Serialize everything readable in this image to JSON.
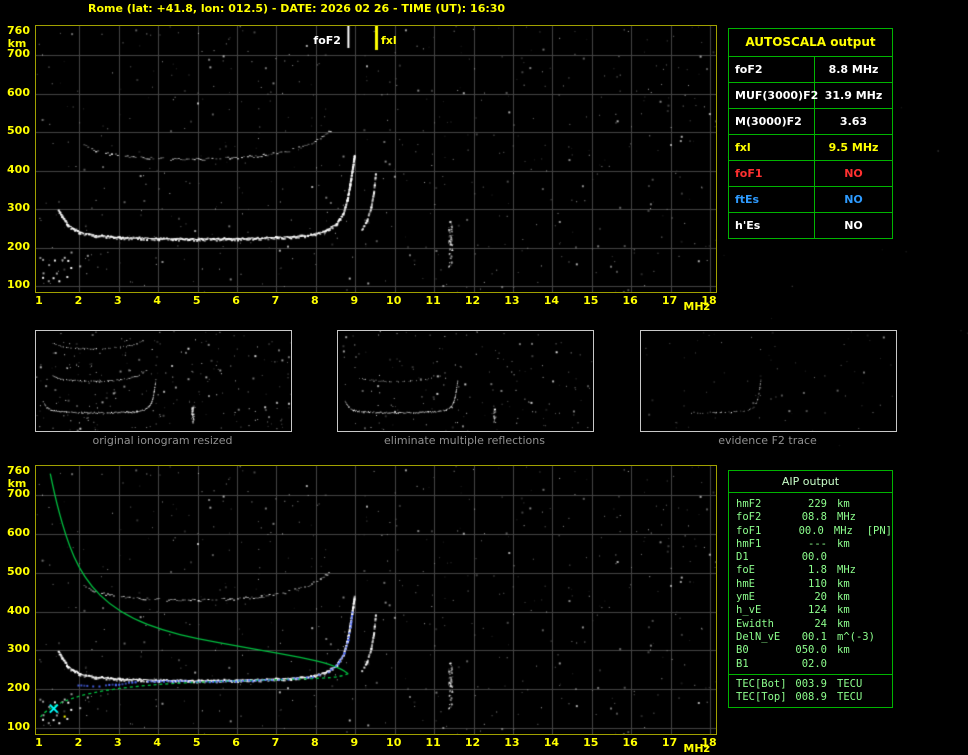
{
  "header": {
    "title": "Rome (lat: +41.8, lon: 012.5) - DATE: 2026 02 26 - TIME (UT): 16:30"
  },
  "colors": {
    "accent_yellow": "#ffff00",
    "grid": "#454545",
    "panel_border": "#a0a000",
    "table_border": "#00b400",
    "aip_text": "#8dff8d",
    "caption_gray": "#909090",
    "trace_blue": "#4d6bff",
    "profile_green": "#00c040",
    "value_red": "#ff3030",
    "value_blue": "#2e9bff",
    "value_white": "#ffffff"
  },
  "axes": {
    "y_ticks": [
      760,
      700,
      600,
      500,
      400,
      300,
      200,
      100
    ],
    "y_unit": "km",
    "x_ticks": [
      1,
      2,
      3,
      4,
      5,
      6,
      7,
      8,
      9,
      10,
      11,
      12,
      13,
      14,
      15,
      16,
      17,
      18
    ],
    "x_unit": "MHz",
    "x_range": [
      1,
      18
    ],
    "y_range": [
      100,
      760
    ]
  },
  "top_panel": {
    "fof2_label": "foF2",
    "fxl_label": "fxl"
  },
  "autoscala": {
    "title": "AUTOSCALA output",
    "rows": [
      {
        "label": "foF2",
        "value": "8.8 MHz",
        "color": "#ffffff"
      },
      {
        "label": "MUF(3000)F2",
        "value": "31.9 MHz",
        "color": "#ffffff"
      },
      {
        "label": "M(3000)F2",
        "value": "3.63",
        "color": "#ffffff"
      },
      {
        "label": "fxl",
        "value": "9.5 MHz",
        "color": "#ffff00"
      },
      {
        "label": "foF1",
        "value": "NO",
        "color": "#ff3030"
      },
      {
        "label": "ftEs",
        "value": "NO",
        "color": "#2e9bff"
      },
      {
        "label": "h'Es",
        "value": "NO",
        "color": "#ffffff"
      }
    ]
  },
  "thumbnails": [
    {
      "caption": "original ionogram resized"
    },
    {
      "caption": "eliminate multiple reflections"
    },
    {
      "caption": "evidence F2 trace"
    }
  ],
  "aip": {
    "title": "AIP output",
    "rows": [
      [
        "hmF2",
        "229",
        "km",
        ""
      ],
      [
        "foF2",
        "08.8",
        "MHz",
        ""
      ],
      [
        "foF1",
        "00.0",
        "MHz",
        "[PN]"
      ],
      [
        "hmF1",
        "---",
        "km",
        ""
      ],
      [
        "D1",
        "00.0",
        "",
        ""
      ],
      [
        "foE",
        "1.8",
        "MHz",
        ""
      ],
      [
        "hmE",
        "110",
        "km",
        ""
      ],
      [
        "ymE",
        "20",
        "km",
        ""
      ],
      [
        "h_vE",
        "124",
        "km",
        ""
      ],
      [
        "Ewidth",
        "24",
        "km",
        ""
      ],
      [
        "DelN_vE",
        "00.1",
        "m^(-3)",
        ""
      ],
      [
        "B0",
        "050.0",
        "km",
        ""
      ],
      [
        "B1",
        "02.0",
        "",
        ""
      ]
    ],
    "tec_rows": [
      [
        "TEC[Bot]",
        "003.9",
        "TECU"
      ],
      [
        "TEC[Top]",
        "008.9",
        "TECU"
      ]
    ]
  },
  "chart_data": {
    "type": "scatter",
    "title": "Ionogram - virtual height (km) vs sounding frequency (MHz)",
    "xlabel": "MHz",
    "ylabel": "km",
    "xlim": [
      1,
      18
    ],
    "ylim": [
      100,
      760
    ],
    "grid": true,
    "markers": {
      "foF2_mhz": 8.8,
      "fxl_mhz": 9.5
    },
    "traces": {
      "f2_main": [
        [
          1.45,
          298
        ],
        [
          1.7,
          258
        ],
        [
          2.0,
          240
        ],
        [
          2.4,
          232
        ],
        [
          3.0,
          227
        ],
        [
          4.0,
          224
        ],
        [
          5.0,
          223
        ],
        [
          6.0,
          224
        ],
        [
          7.0,
          227
        ],
        [
          7.7,
          231
        ],
        [
          8.2,
          243
        ],
        [
          8.5,
          262
        ],
        [
          8.68,
          290
        ],
        [
          8.78,
          325
        ],
        [
          8.85,
          365
        ],
        [
          8.92,
          410
        ],
        [
          8.96,
          440
        ]
      ],
      "second_hop": [
        [
          2.1,
          466
        ],
        [
          2.4,
          452
        ],
        [
          2.8,
          443
        ],
        [
          3.4,
          436
        ],
        [
          4.2,
          431
        ],
        [
          5.0,
          430
        ],
        [
          5.8,
          433
        ],
        [
          6.6,
          440
        ],
        [
          7.2,
          450
        ],
        [
          7.7,
          464
        ],
        [
          8.1,
          484
        ],
        [
          8.35,
          505
        ]
      ],
      "x_mode_rise": [
        [
          9.15,
          248
        ],
        [
          9.28,
          272
        ],
        [
          9.38,
          305
        ],
        [
          9.45,
          345
        ],
        [
          9.5,
          395
        ]
      ],
      "blue_trace": [
        [
          1.95,
          213
        ],
        [
          2.4,
          210
        ],
        [
          2.9,
          214
        ],
        [
          3.4,
          221
        ],
        [
          4.2,
          223
        ],
        [
          5.2,
          222
        ],
        [
          6.2,
          224
        ],
        [
          7.2,
          227
        ],
        [
          7.9,
          233
        ],
        [
          8.3,
          247
        ],
        [
          8.55,
          268
        ],
        [
          8.7,
          295
        ],
        [
          8.8,
          330
        ],
        [
          8.87,
          370
        ],
        [
          8.9,
          400
        ]
      ],
      "profile_topside": [
        [
          1.26,
          756
        ],
        [
          1.33,
          722
        ],
        [
          1.43,
          678
        ],
        [
          1.57,
          625
        ],
        [
          1.75,
          568
        ],
        [
          1.98,
          515
        ],
        [
          2.3,
          465
        ],
        [
          2.75,
          420
        ],
        [
          3.35,
          382
        ],
        [
          4.1,
          352
        ],
        [
          5.0,
          330
        ],
        [
          6.0,
          311
        ],
        [
          7.1,
          292
        ],
        [
          8.1,
          272
        ],
        [
          8.6,
          255
        ],
        [
          8.82,
          240
        ]
      ],
      "profile_bottomside": [
        [
          8.82,
          240
        ],
        [
          8.62,
          232
        ],
        [
          8.1,
          228
        ],
        [
          7.2,
          225
        ],
        [
          6.2,
          222
        ],
        [
          5.2,
          219
        ],
        [
          4.2,
          214
        ],
        [
          3.3,
          206
        ],
        [
          2.6,
          196
        ],
        [
          2.05,
          184
        ],
        [
          1.6,
          169
        ],
        [
          1.3,
          153
        ],
        [
          1.1,
          139
        ],
        [
          1.0,
          127
        ]
      ],
      "noise_column_mhz": 11.4
    }
  }
}
